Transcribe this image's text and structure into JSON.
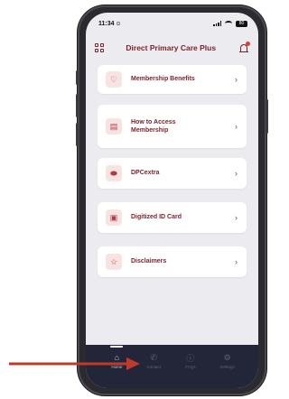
{
  "status_bar": {
    "time": "11:34",
    "battery": "80"
  },
  "header": {
    "title": "Direct Primary Care Plus"
  },
  "menu": [
    {
      "label": "Membership Benefits",
      "icon": "gift-icon"
    },
    {
      "label": "How to Access\nMembership",
      "icon": "document-icon"
    },
    {
      "label": "DPCextra",
      "icon": "pill-icon"
    },
    {
      "label": "Digitized ID Card",
      "icon": "id-card-icon"
    },
    {
      "label": "Disclaimers",
      "icon": "star-icon"
    }
  ],
  "tab_bar": [
    {
      "label": "Home",
      "icon": "home-icon",
      "active": true
    },
    {
      "label": "Contact",
      "icon": "phone-icon",
      "active": false
    },
    {
      "label": "FAQs",
      "icon": "help-icon",
      "active": false
    },
    {
      "label": "Settings",
      "icon": "gear-icon",
      "active": false
    }
  ],
  "colors": {
    "brand": "#7a1f2b",
    "icon_bg": "#f8e3e3",
    "tab_bar_bg": "#222638",
    "screen_bg": "#ececf0",
    "annotation_arrow": "#c0392b"
  }
}
